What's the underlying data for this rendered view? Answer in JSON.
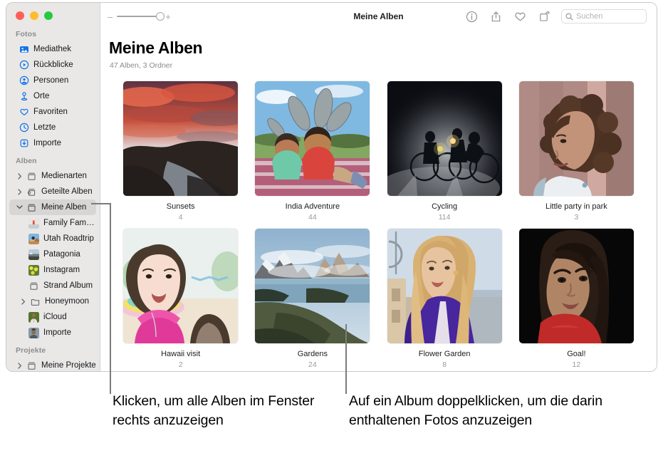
{
  "window": {
    "traffic_lights": [
      "close",
      "minimize",
      "zoom"
    ]
  },
  "toolbar": {
    "zoom_out_label": "–",
    "zoom_in_label": "+",
    "title": "Meine Alben",
    "buttons": [
      {
        "name": "info-icon",
        "label": "Info"
      },
      {
        "name": "share-icon",
        "label": "Teilen"
      },
      {
        "name": "heart-icon",
        "label": "Favorit"
      },
      {
        "name": "rotate-icon",
        "label": "Drehen"
      }
    ],
    "search": {
      "placeholder": "Suchen",
      "value": "",
      "icon": "search-icon"
    }
  },
  "sidebar": {
    "sections": [
      {
        "title": "Fotos",
        "items": [
          {
            "label": "Mediathek",
            "icon": "library-icon",
            "kind": "symbol"
          },
          {
            "label": "Rückblicke",
            "icon": "memories-icon",
            "kind": "symbol"
          },
          {
            "label": "Personen",
            "icon": "people-icon",
            "kind": "symbol"
          },
          {
            "label": "Orte",
            "icon": "places-icon",
            "kind": "symbol"
          },
          {
            "label": "Favoriten",
            "icon": "heart-icon",
            "kind": "symbol"
          },
          {
            "label": "Letzte",
            "icon": "clock-icon",
            "kind": "symbol"
          },
          {
            "label": "Importe",
            "icon": "import-icon",
            "kind": "symbol"
          }
        ]
      },
      {
        "title": "Alben",
        "items": [
          {
            "label": "Medienarten",
            "icon": "album-icon",
            "kind": "folder",
            "disclosure": "collapsed"
          },
          {
            "label": "Geteilte Alben",
            "icon": "shared-album-icon",
            "kind": "folder",
            "disclosure": "collapsed"
          },
          {
            "label": "Meine Alben",
            "icon": "album-icon",
            "kind": "folder",
            "disclosure": "expanded",
            "selected": true
          },
          {
            "label": "Family Family…",
            "icon": "album-thumb-family",
            "kind": "thumb",
            "indent": true
          },
          {
            "label": "Utah Roadtrip",
            "icon": "album-thumb-utah",
            "kind": "thumb",
            "indent": true
          },
          {
            "label": "Patagonia",
            "icon": "album-thumb-patagonia",
            "kind": "thumb",
            "indent": true
          },
          {
            "label": "Instagram",
            "icon": "album-thumb-instagram",
            "kind": "thumb",
            "indent": true
          },
          {
            "label": "Strand Album",
            "icon": "album-icon",
            "kind": "folder",
            "indent": true
          },
          {
            "label": "Honeymoon",
            "icon": "folder-icon",
            "kind": "folder",
            "indent": true,
            "disclosure": "collapsed"
          },
          {
            "label": "iCloud",
            "icon": "album-thumb-icloud",
            "kind": "thumb",
            "indent": true
          },
          {
            "label": "Importe",
            "icon": "album-thumb-importe",
            "kind": "thumb",
            "indent": true
          }
        ]
      },
      {
        "title": "Projekte",
        "items": [
          {
            "label": "Meine Projekte",
            "icon": "album-icon",
            "kind": "folder",
            "disclosure": "collapsed"
          }
        ]
      }
    ]
  },
  "main": {
    "title": "Meine Alben",
    "subtitle": "47 Alben, 3 Ordner",
    "albums": [
      {
        "name": "Sunsets",
        "count": "4",
        "thumb": "sunset-lake"
      },
      {
        "name": "India Adventure",
        "count": "44",
        "thumb": "kids-picnic"
      },
      {
        "name": "Cycling",
        "count": "114",
        "thumb": "night-cyclists"
      },
      {
        "name": "Little party in park",
        "count": "3",
        "thumb": "curly-woman-portrait"
      },
      {
        "name": "Hawaii visit",
        "count": "2",
        "thumb": "girl-pink-top"
      },
      {
        "name": "Gardens",
        "count": "24",
        "thumb": "mountain-lake"
      },
      {
        "name": "Flower Garden",
        "count": "8",
        "thumb": "blonde-curly-woman"
      },
      {
        "name": "Goal!",
        "count": "12",
        "thumb": "dark-portrait-red"
      }
    ]
  },
  "callouts": {
    "left": "Klicken, um alle Alben im Fenster rechts anzuzeigen",
    "right": "Auf ein Album doppelklicken, um die darin enthaltenen Fotos anzuzeigen"
  },
  "colors": {
    "accent_blue": "#1473e6",
    "sidebar_bg": "#e9e8e7",
    "selected_bg": "#d7d6d5",
    "leader_line": "#7b7b7b",
    "caption": "#1d1d1f",
    "count_text": "#9a9a9e"
  }
}
